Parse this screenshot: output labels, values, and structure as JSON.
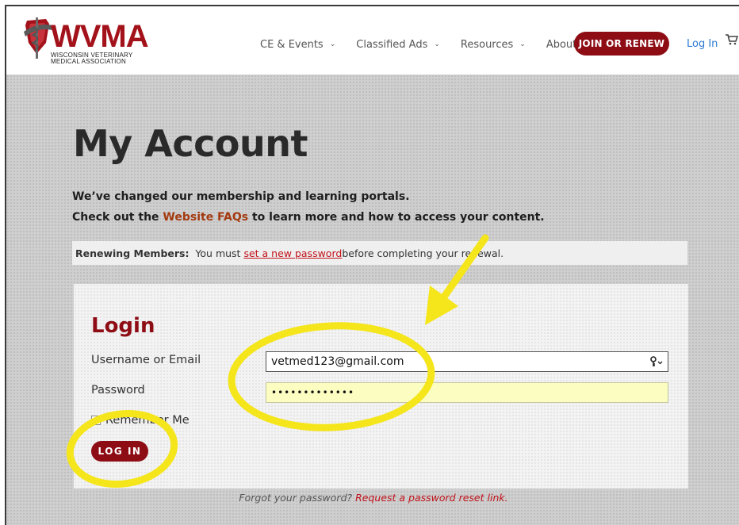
{
  "brand": {
    "logo_text": "WVMA",
    "logo_sub_line1": "WISCONSIN VETERINARY",
    "logo_sub_line2": "MEDICAL ASSOCIATION",
    "primary_color": "#8e0d15",
    "link_color": "#2a7bd1"
  },
  "nav": {
    "items": [
      {
        "label": "CE & Events"
      },
      {
        "label": "Classified Ads"
      },
      {
        "label": "Resources"
      },
      {
        "label": "About Us"
      }
    ],
    "join_label": "JOIN OR RENEW",
    "login_label": "Log In",
    "cart_icon": "cart-icon"
  },
  "page": {
    "title": "My Account",
    "intro_line1": "We’ve changed our membership and learning portals.",
    "intro_line2_prefix": "Check out the ",
    "intro_line2_link": "Website FAQs",
    "intro_line2_suffix": " to learn more and how to access your content."
  },
  "notice": {
    "label": "Renewing Members:",
    "text_before": "  You must ",
    "link": "set a new password",
    "text_after": " before completing your renewal."
  },
  "login": {
    "heading": "Login",
    "username_label": "Username or Email",
    "username_value": "vetmed123@gmail.com",
    "password_label": "Password",
    "password_value": "•••••••••••••",
    "remember_label": "Remember Me",
    "remember_checked": false,
    "submit_label": "LOG IN"
  },
  "forgot": {
    "text": "Forgot your password? ",
    "link": "Request a password reset link."
  },
  "annotation": {
    "highlight_color": "#f5e51b"
  }
}
